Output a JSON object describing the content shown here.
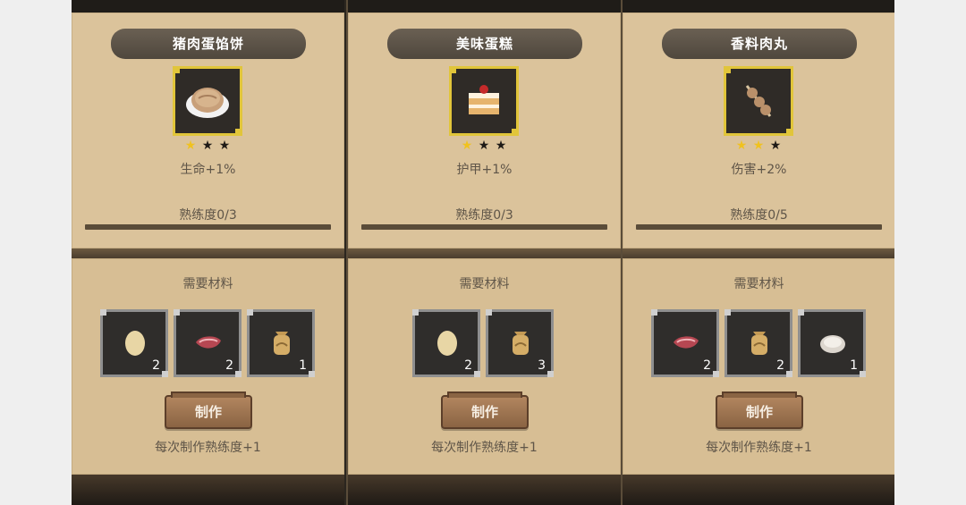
{
  "columns": [
    {
      "title": "猪肉蛋馅饼",
      "food_icon": "pork-egg-pie-icon",
      "stars": [
        "★",
        "★",
        "★"
      ],
      "stars_filled": 1,
      "effect": "生命+1%",
      "mastery": "熟练度0/3",
      "mastery_progress": 0,
      "materials_label": "需要材料",
      "materials": [
        {
          "icon": "egg-icon",
          "count": "2"
        },
        {
          "icon": "pork-icon",
          "count": "2"
        },
        {
          "icon": "flour-sack-icon",
          "count": "1"
        }
      ],
      "craft_button": "制作",
      "craft_note": "每次制作熟练度+1"
    },
    {
      "title": "美味蛋糕",
      "food_icon": "cake-icon",
      "stars": [
        "★",
        "★",
        "★"
      ],
      "stars_filled": 1,
      "effect": "护甲+1%",
      "mastery": "熟练度0/3",
      "mastery_progress": 0,
      "materials_label": "需要材料",
      "materials": [
        {
          "icon": "egg-icon",
          "count": "2"
        },
        {
          "icon": "flour-sack-icon",
          "count": "3"
        }
      ],
      "craft_button": "制作",
      "craft_note": "每次制作熟练度+1"
    },
    {
      "title": "香料肉丸",
      "food_icon": "meatball-skewer-icon",
      "stars": [
        "★",
        "★",
        "★"
      ],
      "stars_filled": 2,
      "effect": "伤害+2%",
      "mastery": "熟练度0/5",
      "mastery_progress": 0,
      "materials_label": "需要材料",
      "materials": [
        {
          "icon": "pork-icon",
          "count": "2"
        },
        {
          "icon": "flour-sack-icon",
          "count": "2"
        },
        {
          "icon": "salt-bowl-icon",
          "count": "1"
        }
      ],
      "craft_button": "制作",
      "craft_note": "每次制作熟练度+1"
    }
  ],
  "colors": {
    "panel": "#dbc39b",
    "text": "#5f5548",
    "gold": "#e1c53a",
    "banner": "#5c544a"
  }
}
